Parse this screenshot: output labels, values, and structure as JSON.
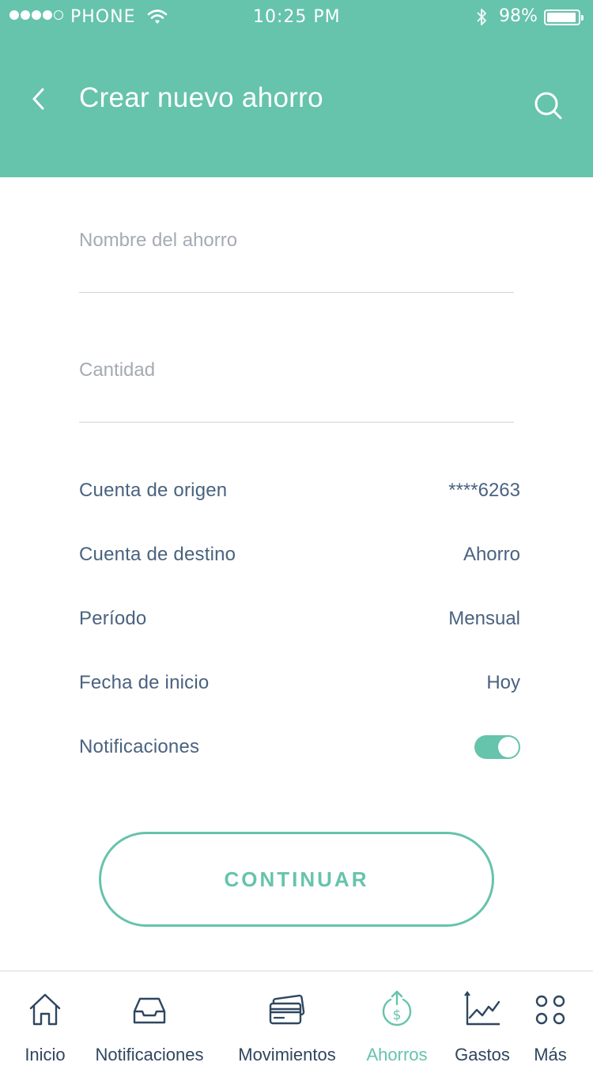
{
  "status_bar": {
    "carrier": "PHONE",
    "time": "10:25 PM",
    "battery": "98%",
    "signal_bars_filled": 4,
    "signal_bars_total": 5,
    "battery_level": 0.98
  },
  "header": {
    "title": "Crear nuevo ahorro",
    "back_icon": "chevron-left-icon",
    "search_icon": "search-icon"
  },
  "form": {
    "name_placeholder": "Nombre del ahorro",
    "name_value": "",
    "amount_placeholder": "Cantidad",
    "amount_value": ""
  },
  "details": [
    {
      "label": "Cuenta de origen",
      "value": "****6263"
    },
    {
      "label": "Cuenta de destino",
      "value": "Ahorro"
    },
    {
      "label": "Período",
      "value": "Mensual"
    },
    {
      "label": "Fecha de inicio",
      "value": "Hoy"
    }
  ],
  "notifications": {
    "label": "Notificaciones",
    "enabled": true
  },
  "continue_label": "CONTINUAR",
  "tabs": [
    {
      "label": "Inicio",
      "icon": "home-icon"
    },
    {
      "label": "Notificaciones",
      "icon": "inbox-icon"
    },
    {
      "label": "Movimientos",
      "icon": "cards-icon"
    },
    {
      "label": "Ahorros",
      "icon": "savings-icon",
      "active": true
    },
    {
      "label": "Gastos",
      "icon": "chart-icon"
    },
    {
      "label": "Más",
      "icon": "more-icon"
    }
  ],
  "colors": {
    "accent": "#66c3ac",
    "text": "#4a6280",
    "placeholder": "#a5abb2"
  }
}
